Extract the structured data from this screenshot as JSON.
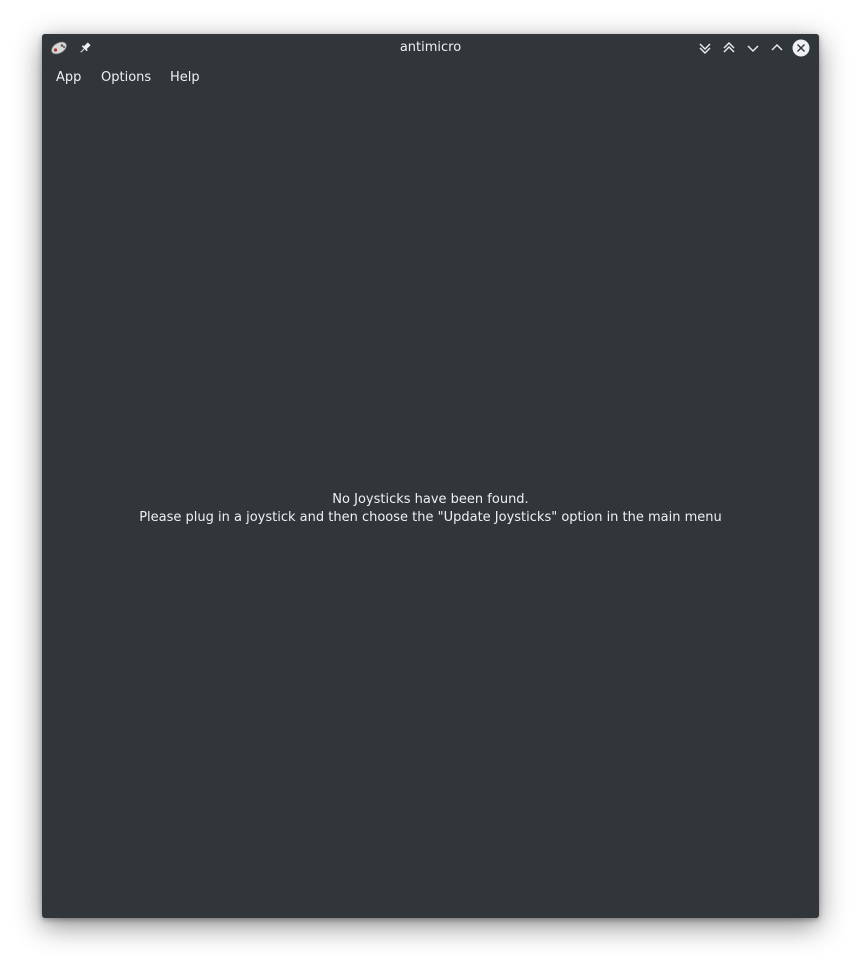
{
  "window": {
    "title": "antimicro"
  },
  "titlebar": {
    "app_icon": "gamepad-icon",
    "pin_icon": "pin-icon",
    "buttons": [
      {
        "icon": "keep-below-icon"
      },
      {
        "icon": "keep-above-icon"
      },
      {
        "icon": "minimize-icon"
      },
      {
        "icon": "maximize-icon"
      },
      {
        "icon": "close-icon"
      }
    ]
  },
  "menubar": {
    "items": [
      {
        "label": "App"
      },
      {
        "label": "Options"
      },
      {
        "label": "Help"
      }
    ]
  },
  "content": {
    "line1": "No Joysticks have been found.",
    "line2": "Please plug in a joystick and then choose the \"Update Joysticks\" option in the main menu"
  },
  "colors": {
    "window_bg": "#31363b",
    "text": "#eff0f1",
    "close_button_bg": "#eff0f1"
  }
}
